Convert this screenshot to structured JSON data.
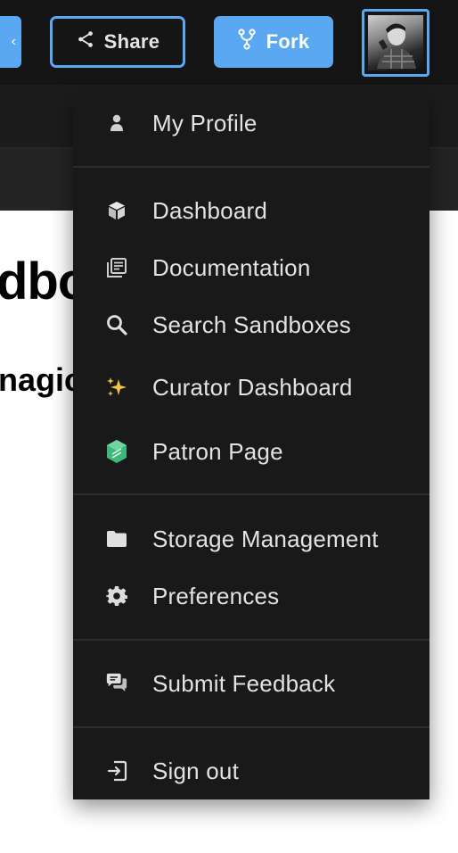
{
  "toolbar": {
    "share_label": "Share",
    "fork_label": "Fork",
    "accent": "#5aa7f2"
  },
  "page": {
    "title_fragment": "dbo",
    "subtitle_fragment": "nagic"
  },
  "menu": {
    "items": [
      {
        "label": "My Profile",
        "icon": "user-icon"
      },
      {
        "label": "Dashboard",
        "icon": "cube-icon"
      },
      {
        "label": "Documentation",
        "icon": "docs-icon"
      },
      {
        "label": "Search Sandboxes",
        "icon": "search-icon"
      },
      {
        "label": "Curator Dashboard",
        "icon": "sparkles-icon"
      },
      {
        "label": "Patron Page",
        "icon": "patron-icon"
      },
      {
        "label": "Storage Management",
        "icon": "folder-icon"
      },
      {
        "label": "Preferences",
        "icon": "gear-icon"
      },
      {
        "label": "Submit Feedback",
        "icon": "feedback-icon"
      },
      {
        "label": "Sign out",
        "icon": "sign-out-icon"
      }
    ]
  }
}
